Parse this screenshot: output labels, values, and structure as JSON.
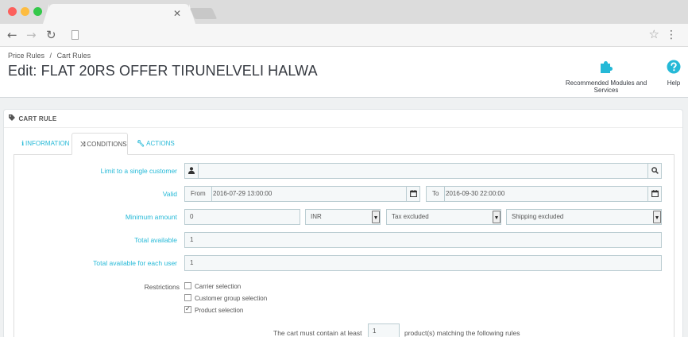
{
  "browser": {
    "tab_close": "✕",
    "back": "←",
    "forward": "→",
    "reload": "↻",
    "star": "☆",
    "menu": "⋮"
  },
  "header": {
    "breadcrumb": [
      "Price Rules",
      "/",
      "Cart Rules"
    ],
    "title": "Edit: FLAT 20RS OFFER TIRUNELVELI HALWA",
    "toolbar": {
      "modules_label": "Recommended Modules and Services",
      "help_label": "Help"
    }
  },
  "panel": {
    "heading": "CART RULE",
    "tabs": [
      {
        "label": "INFORMATION",
        "icon": "info-icon"
      },
      {
        "label": "CONDITIONS",
        "icon": "shuffle-icon"
      },
      {
        "label": "ACTIONS",
        "icon": "wrench-icon"
      }
    ]
  },
  "conditions": {
    "limit_customer_label": "Limit to a single customer",
    "limit_customer_value": "",
    "valid_label": "Valid",
    "from_label": "From",
    "from_value": "2016-07-29 13:00:00",
    "to_label": "To",
    "to_value": "2016-09-30 22:00:00",
    "min_amount_label": "Minimum amount",
    "min_amount_value": "0",
    "currency_value": "INR",
    "tax_value": "Tax excluded",
    "shipping_value": "Shipping excluded",
    "total_available_label": "Total available",
    "total_available_value": "1",
    "total_per_user_label": "Total available for each user",
    "total_per_user_value": "1",
    "restrictions_label": "Restrictions",
    "restrictions": [
      {
        "label": "Carrier selection",
        "checked": false
      },
      {
        "label": "Customer group selection",
        "checked": false
      },
      {
        "label": "Product selection",
        "checked": true
      }
    ],
    "cart_must_contain": "The cart must contain at least",
    "cart_qty": "1",
    "cart_matching": "product(s) matching the following rules"
  },
  "colors": {
    "accent": "#25b9d7",
    "title": "#363a41",
    "border": "#bbcdd2"
  }
}
